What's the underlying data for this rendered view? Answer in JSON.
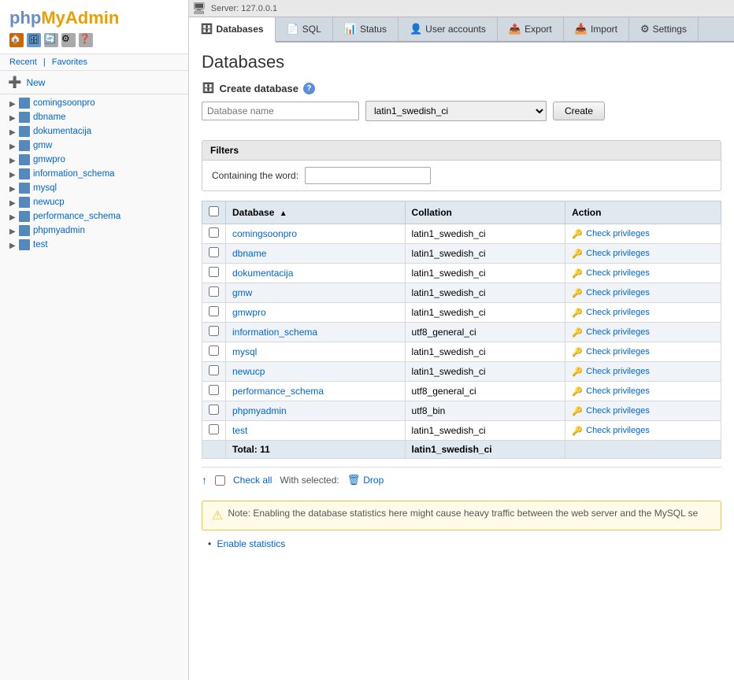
{
  "topbar": {
    "server_label": "Server: 127.0.0.1"
  },
  "sidebar": {
    "logo_php": "php",
    "logo_my": "My",
    "logo_admin": "Admin",
    "nav": {
      "recent": "Recent",
      "favorites": "Favorites"
    },
    "new_label": "New",
    "databases": [
      "comingsoonpro",
      "dbname",
      "dokumentacija",
      "gmw",
      "gmwpro",
      "information_schema",
      "mysql",
      "newucp",
      "performance_schema",
      "phpmyadmin",
      "test"
    ]
  },
  "tabs": [
    {
      "id": "databases",
      "label": "Databases",
      "active": true
    },
    {
      "id": "sql",
      "label": "SQL",
      "active": false
    },
    {
      "id": "status",
      "label": "Status",
      "active": false
    },
    {
      "id": "user-accounts",
      "label": "User accounts",
      "active": false
    },
    {
      "id": "export",
      "label": "Export",
      "active": false
    },
    {
      "id": "import",
      "label": "Import",
      "active": false
    },
    {
      "id": "settings",
      "label": "Settings",
      "active": false
    }
  ],
  "page": {
    "title": "Databases"
  },
  "create_db": {
    "label": "Create database",
    "name_placeholder": "Database name",
    "collation_value": "latin1_swedish_ci",
    "create_btn": "Create"
  },
  "filters": {
    "title": "Filters",
    "containing_label": "Containing the word:",
    "input_placeholder": ""
  },
  "table": {
    "col_database": "Database",
    "col_collation": "Collation",
    "col_action": "Action",
    "check_privileges": "Check privileges",
    "rows": [
      {
        "name": "comingsoonpro",
        "collation": "latin1_swedish_ci",
        "highlighted": false
      },
      {
        "name": "dbname",
        "collation": "latin1_swedish_ci",
        "highlighted": true
      },
      {
        "name": "dokumentacija",
        "collation": "latin1_swedish_ci",
        "highlighted": false
      },
      {
        "name": "gmw",
        "collation": "latin1_swedish_ci",
        "highlighted": true
      },
      {
        "name": "gmwpro",
        "collation": "latin1_swedish_ci",
        "highlighted": false
      },
      {
        "name": "information_schema",
        "collation": "utf8_general_ci",
        "highlighted": true
      },
      {
        "name": "mysql",
        "collation": "latin1_swedish_ci",
        "highlighted": false
      },
      {
        "name": "newucp",
        "collation": "latin1_swedish_ci",
        "highlighted": true
      },
      {
        "name": "performance_schema",
        "collation": "utf8_general_ci",
        "highlighted": false
      },
      {
        "name": "phpmyadmin",
        "collation": "utf8_bin",
        "highlighted": true
      },
      {
        "name": "test",
        "collation": "latin1_swedish_ci",
        "highlighted": false
      }
    ],
    "total_label": "Total: 11",
    "total_collation": "latin1_swedish_ci"
  },
  "bottom_controls": {
    "check_all": "Check all",
    "with_selected": "With selected:",
    "drop": "Drop"
  },
  "warning": {
    "text": "Note: Enabling the database statistics here might cause heavy traffic between the web server and the MySQL se"
  },
  "enable_stats": {
    "label": "Enable statistics"
  }
}
